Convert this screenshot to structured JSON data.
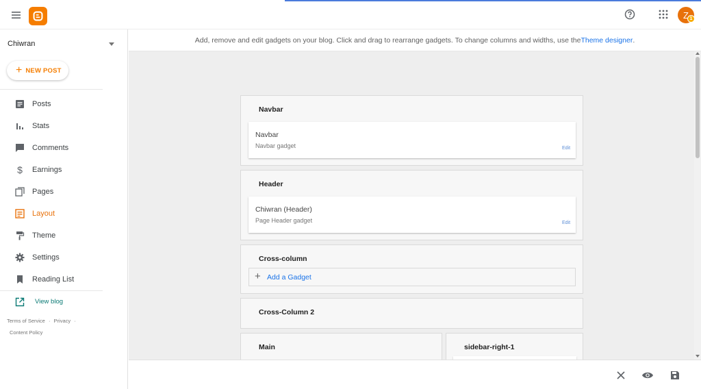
{
  "topbar": {
    "avatar_letter": "Z",
    "badge_text": "1",
    "accent": "#f57d00"
  },
  "sidebar": {
    "blog_name": "Chiwran",
    "new_post_label": "NEW POST",
    "items": [
      {
        "label": "Posts",
        "icon": "posts-icon"
      },
      {
        "label": "Stats",
        "icon": "stats-icon"
      },
      {
        "label": "Comments",
        "icon": "comments-icon"
      },
      {
        "label": "Earnings",
        "icon": "dollar-icon"
      },
      {
        "label": "Pages",
        "icon": "pages-icon"
      },
      {
        "label": "Layout",
        "icon": "layout-icon",
        "active": true
      },
      {
        "label": "Theme",
        "icon": "paint-roller-icon"
      },
      {
        "label": "Settings",
        "icon": "gear-icon"
      },
      {
        "label": "Reading List",
        "icon": "bookmark-icon"
      }
    ],
    "view_blog_label": "View blog",
    "footer": {
      "terms": "Terms of Service",
      "sep": "·",
      "privacy": "Privacy",
      "content_policy": "Content Policy"
    }
  },
  "infobar": {
    "text": "Add, remove and edit gadgets on your blog. Click and drag to rearrange gadgets. To change columns and widths, use the ",
    "link": "Theme designer",
    "after": "."
  },
  "layout": {
    "navbar": {
      "title": "Navbar",
      "gadget_name": "Navbar",
      "gadget_type": "Navbar gadget",
      "edit": "Edit"
    },
    "header": {
      "title": "Header",
      "gadget_name": "Chiwran (Header)",
      "gadget_type": "Page Header gadget",
      "edit": "Edit"
    },
    "cross_column": {
      "title": "Cross-column",
      "add_gadget": "Add a Gadget"
    },
    "cross_column_2": {
      "title": "Cross-Column 2"
    },
    "main": {
      "title": "Main"
    },
    "sidebar_right_1": {
      "title": "sidebar-right-1"
    }
  }
}
